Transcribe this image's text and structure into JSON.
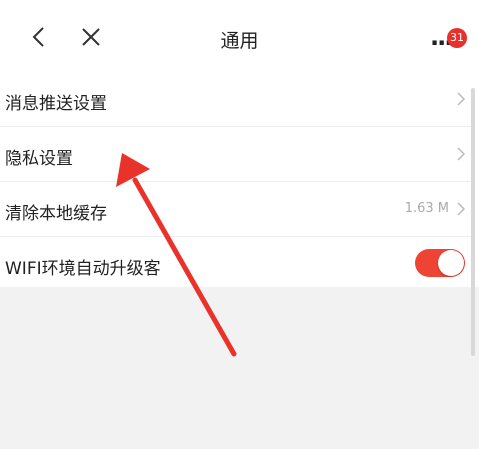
{
  "navbar": {
    "title": "通用",
    "back_icon": "chevron-left-icon",
    "close_icon": "close-icon",
    "more_icon": "more-dots-icon",
    "more_dots": "···",
    "badge_count": "31"
  },
  "settings": {
    "items": [
      {
        "label": "消息推送设置",
        "type": "link"
      },
      {
        "label": "隐私设置",
        "type": "link"
      },
      {
        "label": "清除本地缓存",
        "value": "1.63 M",
        "type": "link"
      },
      {
        "label": "WIFI环境自动升级客",
        "type": "toggle",
        "enabled": true
      }
    ]
  },
  "colors": {
    "accent": "#ee4434",
    "badge": "#e8302c",
    "annotation_arrow": "#e8322a",
    "background_gray": "#f2f2f2"
  }
}
